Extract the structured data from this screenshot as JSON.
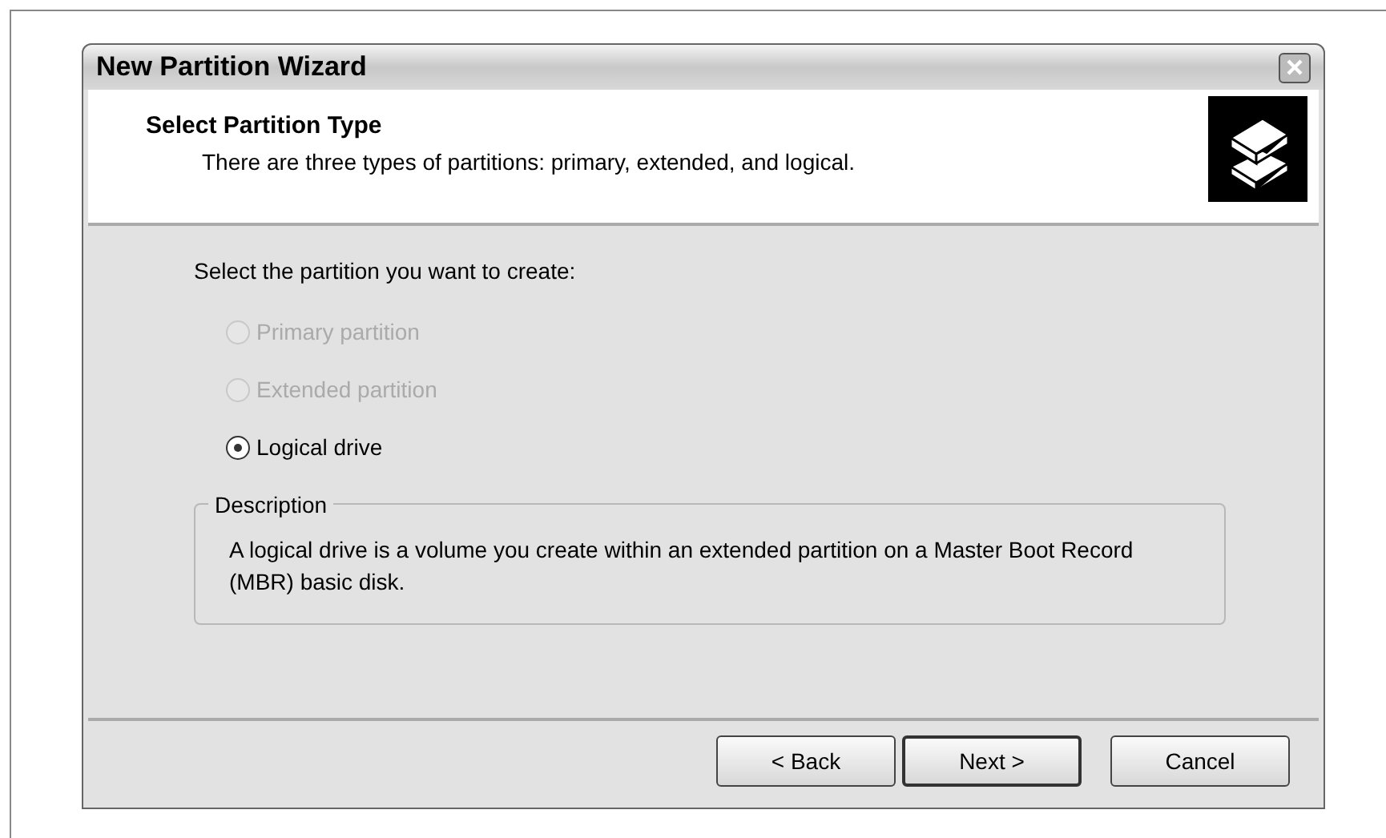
{
  "window": {
    "title": "New Partition Wizard"
  },
  "header": {
    "title": "Select Partition Type",
    "subtitle": "There are three types of partitions: primary, extended, and logical."
  },
  "prompt": "Select the partition you want to create:",
  "options": [
    {
      "label": "Primary partition",
      "selected": false,
      "disabled": true
    },
    {
      "label": "Extended partition",
      "selected": false,
      "disabled": true
    },
    {
      "label": "Logical drive",
      "selected": true,
      "disabled": false
    }
  ],
  "description": {
    "legend": "Description",
    "text": "A logical drive is a volume you create within an extended partition on a Master Boot Record (MBR) basic disk."
  },
  "buttons": [
    {
      "label": "< Back",
      "default": false
    },
    {
      "label": "Next >",
      "default": true
    },
    {
      "label": "Cancel",
      "default": false
    }
  ]
}
